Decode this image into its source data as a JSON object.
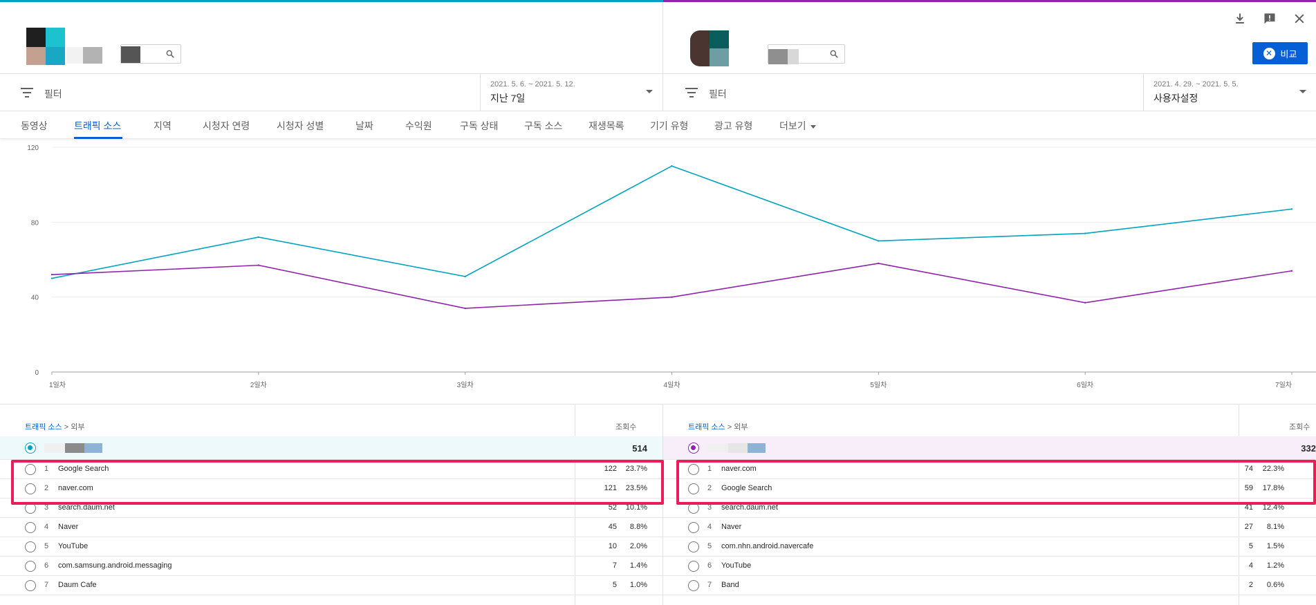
{
  "header": {
    "download_icon": "download-icon",
    "feedback_icon": "feedback-icon",
    "close_icon": "close-icon",
    "compare_button": "비교"
  },
  "left": {
    "filter_label": "필터",
    "date_small": "2021. 5. 6. ~ 2021. 5. 12.",
    "date_main": "지난 7일",
    "crumb_link": "트래픽 소스",
    "crumb_rest": " > 외부",
    "col_views": "조회수",
    "total": "514",
    "rows": [
      {
        "rank": "1",
        "name": "Google Search",
        "views": "122",
        "pct": "23.7%"
      },
      {
        "rank": "2",
        "name": "naver.com",
        "views": "121",
        "pct": "23.5%"
      },
      {
        "rank": "3",
        "name": "search.daum.net",
        "views": "52",
        "pct": "10.1%"
      },
      {
        "rank": "4",
        "name": "Naver",
        "views": "45",
        "pct": "8.8%"
      },
      {
        "rank": "5",
        "name": "YouTube",
        "views": "10",
        "pct": "2.0%"
      },
      {
        "rank": "6",
        "name": "com.samsung.android.messaging",
        "views": "7",
        "pct": "1.4%"
      },
      {
        "rank": "7",
        "name": "Daum Cafe",
        "views": "5",
        "pct": "1.0%"
      }
    ]
  },
  "right": {
    "filter_label": "필터",
    "date_small": "2021. 4. 29. ~ 2021. 5. 5.",
    "date_main": "사용자설정",
    "crumb_link": "트래픽 소스",
    "crumb_rest": " > 외부",
    "col_views": "조회수",
    "total": "332",
    "rows": [
      {
        "rank": "1",
        "name": "naver.com",
        "views": "74",
        "pct": "22.3%"
      },
      {
        "rank": "2",
        "name": "Google Search",
        "views": "59",
        "pct": "17.8%"
      },
      {
        "rank": "3",
        "name": "search.daum.net",
        "views": "41",
        "pct": "12.4%"
      },
      {
        "rank": "4",
        "name": "Naver",
        "views": "27",
        "pct": "8.1%"
      },
      {
        "rank": "5",
        "name": "com.nhn.android.navercafe",
        "views": "5",
        "pct": "1.5%"
      },
      {
        "rank": "6",
        "name": "YouTube",
        "views": "4",
        "pct": "1.2%"
      },
      {
        "rank": "7",
        "name": "Band",
        "views": "2",
        "pct": "0.6%"
      }
    ]
  },
  "tabs": [
    "동영상",
    "트래픽 소스",
    "지역",
    "시청자 연령",
    "시청자 성별",
    "날짜",
    "수익원",
    "구독 상태",
    "구독 소스",
    "재생목록",
    "기기 유형",
    "광고 유형",
    "더보기"
  ],
  "active_tab": "트래픽 소스",
  "chart_data": {
    "type": "line",
    "categories": [
      "1일차",
      "2일차",
      "3일차",
      "4일차",
      "5일차",
      "6일차",
      "7일차"
    ],
    "ylim": [
      0,
      120
    ],
    "yticks": [
      "0",
      "40",
      "80",
      "120"
    ],
    "grid": true,
    "series": [
      {
        "color": "#00a3bf",
        "values": [
          50,
          72,
          51,
          110,
          70,
          74,
          87
        ]
      },
      {
        "color": "#8e24aa",
        "values": [
          52,
          57,
          34,
          40,
          58,
          37,
          54
        ]
      }
    ]
  },
  "colors": {
    "accent": "#065fd4",
    "series_a": "#00a3bf",
    "series_b": "#8e24aa",
    "highlight": "#ec1c5a"
  }
}
